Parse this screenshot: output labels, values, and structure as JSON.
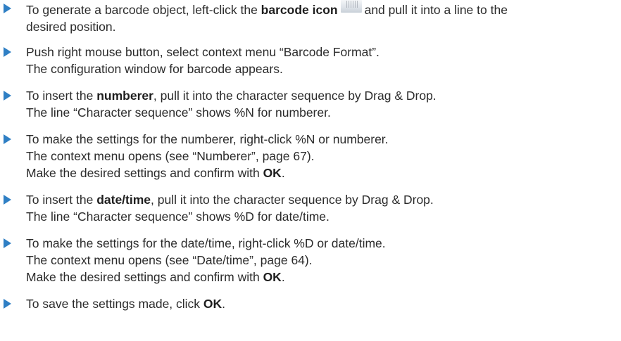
{
  "items": [
    {
      "lines": [
        {
          "pre": "To generate a barcode object, left-click the ",
          "bold": "barcode icon",
          "icon": "barcode-icon",
          "post": "and pull it into a line to the"
        },
        {
          "pre": "desired position."
        }
      ]
    },
    {
      "lines": [
        {
          "pre": "Push right mouse button, select context menu “Barcode Format”."
        },
        {
          "pre": "The configuration window for barcode appears."
        }
      ]
    },
    {
      "lines": [
        {
          "pre": "To insert the ",
          "bold": "numberer",
          "post": ", pull it into the character sequence by Drag & Drop."
        },
        {
          "pre": "The line “Character sequence” shows %N for numberer."
        }
      ]
    },
    {
      "lines": [
        {
          "pre": "To make the settings for the numberer, right-click %N or numberer."
        },
        {
          "pre": "The context menu opens (see “Numberer”, page 67)."
        },
        {
          "pre": "Make the desired settings and confirm with ",
          "bold": "OK",
          "post": "."
        }
      ]
    },
    {
      "lines": [
        {
          "pre": "To insert the ",
          "bold": "date/time",
          "post": ", pull it into the character sequence by Drag & Drop."
        },
        {
          "pre": "The line “Character sequence” shows %D for date/time."
        }
      ]
    },
    {
      "lines": [
        {
          "pre": "To make the settings for the date/time, right-click %D or date/time."
        },
        {
          "pre": "The context menu opens (see “Date/time”, page 64)."
        },
        {
          "pre": "Make the desired settings and confirm with ",
          "bold": "OK",
          "post": "."
        }
      ]
    },
    {
      "lines": [
        {
          "pre": "To save the settings made, click ",
          "bold": "OK",
          "post": "."
        }
      ]
    }
  ],
  "colors": {
    "bullet": "#2f7fc4",
    "text": "#2b2b2b"
  }
}
